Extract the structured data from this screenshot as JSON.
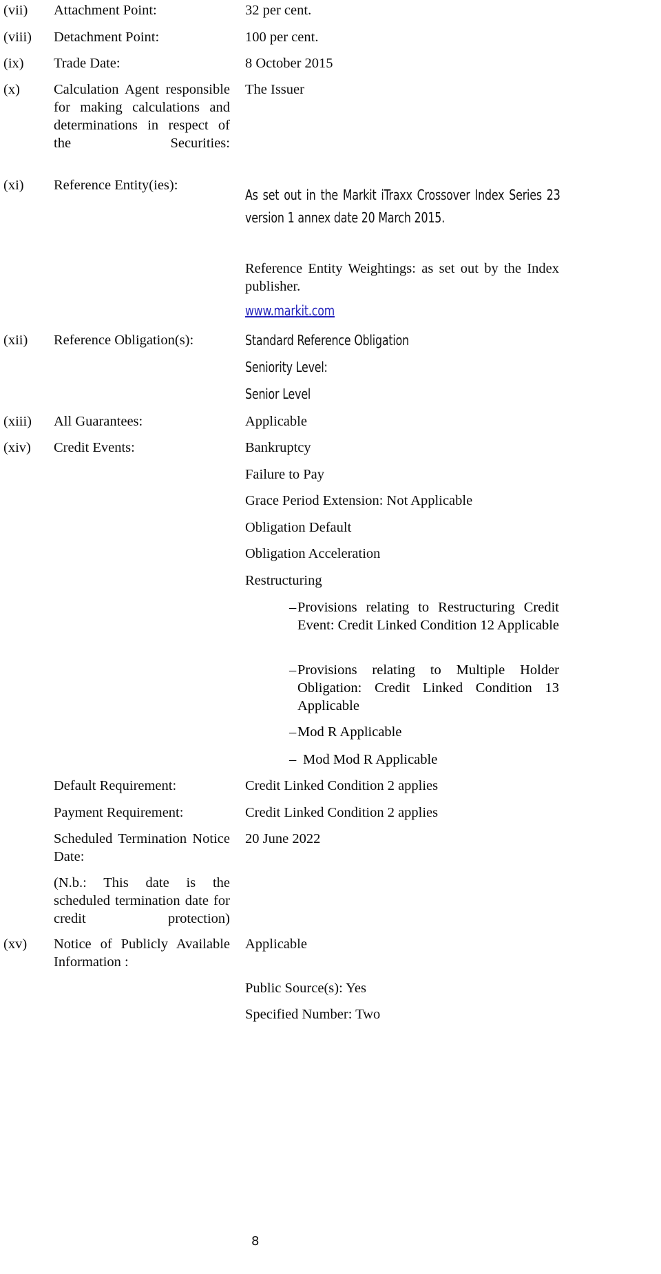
{
  "document": {
    "page_number": "8",
    "link_color": "#2222bb"
  },
  "rows": [
    {
      "numeral": "(vii)",
      "label": "Attachment Point:",
      "value": "32 per cent."
    },
    {
      "numeral": "(viii)",
      "label": "Detachment Point:",
      "value": "100 per cent."
    },
    {
      "numeral": "(ix)",
      "label": "Trade Date:",
      "value": "8 October 2015"
    },
    {
      "numeral": "(x)",
      "label": "Calculation Agent responsible for making calculations and determinations in respect of the Securities:",
      "value": "The Issuer"
    },
    {
      "numeral": "(xi)",
      "label": "Reference Entity(ies):",
      "value_markit": "As set out in the Markit iTraxx Crossover Index Series 23 version 1 annex date 20 March 2015.",
      "value_weightings": "Reference Entity Weightings: as set out by the Index publisher.",
      "value_link": "www.markit.com"
    },
    {
      "numeral": "(xii)",
      "label": "Reference Obligation(s):",
      "value_sro": "Standard Reference Obligation",
      "value_seniority_label": "Seniority Level:",
      "value_seniority": "Senior Level"
    },
    {
      "numeral": "(xiii)",
      "label": "All Guarantees:",
      "value": "Applicable"
    },
    {
      "numeral": "(xiv)",
      "label": "Credit Events:",
      "credit_events": [
        "Bankruptcy",
        "Failure to Pay",
        "Grace Period Extension: Not Applicable",
        "Obligation Default",
        "Obligation Acceleration",
        "Restructuring"
      ],
      "bullets": [
        "Provisions relating to Restructuring Credit Event: Credit Linked Condition 12 Applicable",
        "Provisions relating to Multiple Holder Obligation: Credit Linked Condition 13 Applicable",
        "Mod R Applicable",
        "Mod Mod R Applicable"
      ],
      "bullet_marker": "–",
      "sub_rows": [
        {
          "label": "Default Requirement:",
          "value": "Credit Linked Condition 2 applies"
        },
        {
          "label": "Payment Requirement:",
          "value": "Credit Linked Condition 2 applies"
        },
        {
          "label": "Scheduled Termination Notice Date:",
          "value": "20 June 2022"
        }
      ],
      "note": "(N.b.: This date is the scheduled termination date for credit protection)"
    },
    {
      "numeral": "(xv)",
      "label": "Notice of Publicly Available Information :",
      "value": "Applicable",
      "extra_values": [
        "Public Source(s):  Yes",
        "Specified Number: Two"
      ]
    }
  ]
}
